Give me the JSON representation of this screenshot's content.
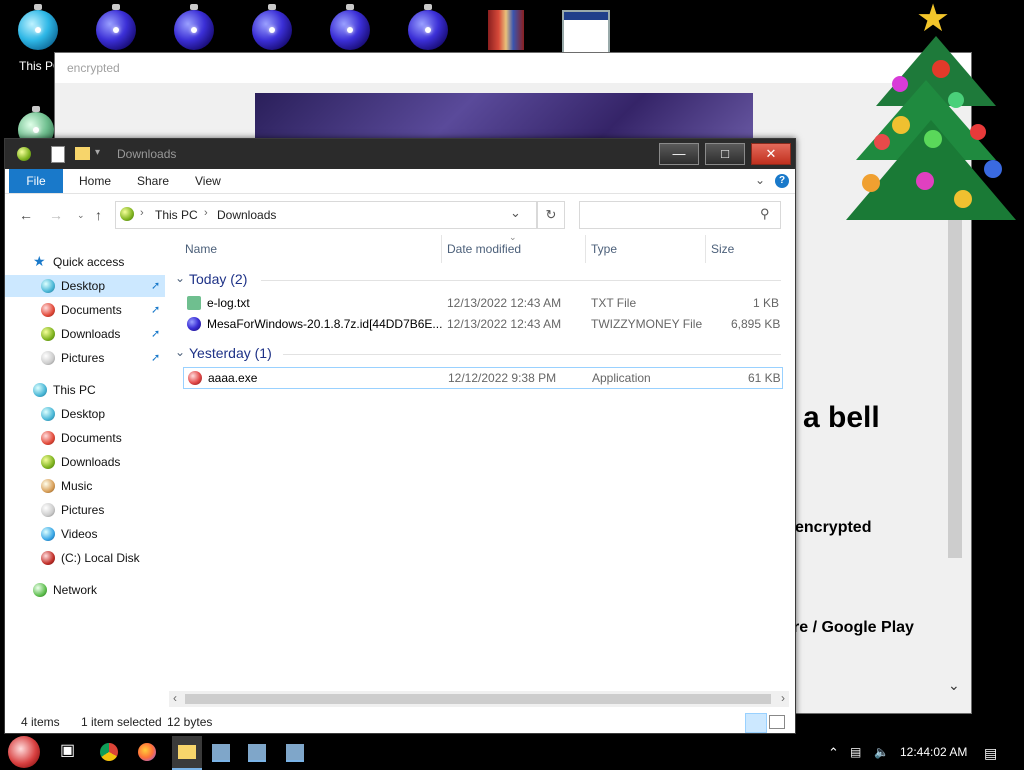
{
  "desktop": {
    "this_pc_label": "This PC"
  },
  "background_window": {
    "title": "encrypted",
    "text_bell": "a bell",
    "text_encrypted": "encrypted",
    "text_store": "re / Google Play"
  },
  "explorer": {
    "title": "Downloads",
    "ribbon": {
      "file": "File",
      "home": "Home",
      "share": "Share",
      "view": "View"
    },
    "address": {
      "crumb1": "This PC",
      "crumb2": "Downloads"
    },
    "search_placeholder": "",
    "nav": {
      "quick_access": "Quick access",
      "qa_desktop": "Desktop",
      "qa_documents": "Documents",
      "qa_downloads": "Downloads",
      "qa_pictures": "Pictures",
      "this_pc": "This PC",
      "pc_desktop": "Desktop",
      "pc_documents": "Documents",
      "pc_downloads": "Downloads",
      "pc_music": "Music",
      "pc_pictures": "Pictures",
      "pc_videos": "Videos",
      "pc_local_disk": "(C:) Local Disk",
      "network": "Network"
    },
    "columns": {
      "name": "Name",
      "date": "Date modified",
      "type": "Type",
      "size": "Size"
    },
    "groups": {
      "today": "Today (2)",
      "yesterday": "Yesterday (1)"
    },
    "files": [
      {
        "name": "e-log.txt",
        "date": "12/13/2022 12:43 AM",
        "type": "TXT File",
        "size": "1 KB"
      },
      {
        "name": "MesaForWindows-20.1.8.7z.id[44DD7B6E...",
        "date": "12/13/2022 12:43 AM",
        "type": "TWIZZYMONEY File",
        "size": "6,895 KB"
      },
      {
        "name": "aaaa.exe",
        "date": "12/12/2022 9:38 PM",
        "type": "Application",
        "size": "61 KB"
      }
    ],
    "status": {
      "items": "4 items",
      "selected": "1 item selected",
      "bytes": "12 bytes"
    }
  },
  "taskbar": {
    "clock": "12:44:02 AM"
  },
  "colors": {
    "file_tab": "#1979ca",
    "selection": "#cce8ff",
    "group_header": "#1e3287"
  }
}
